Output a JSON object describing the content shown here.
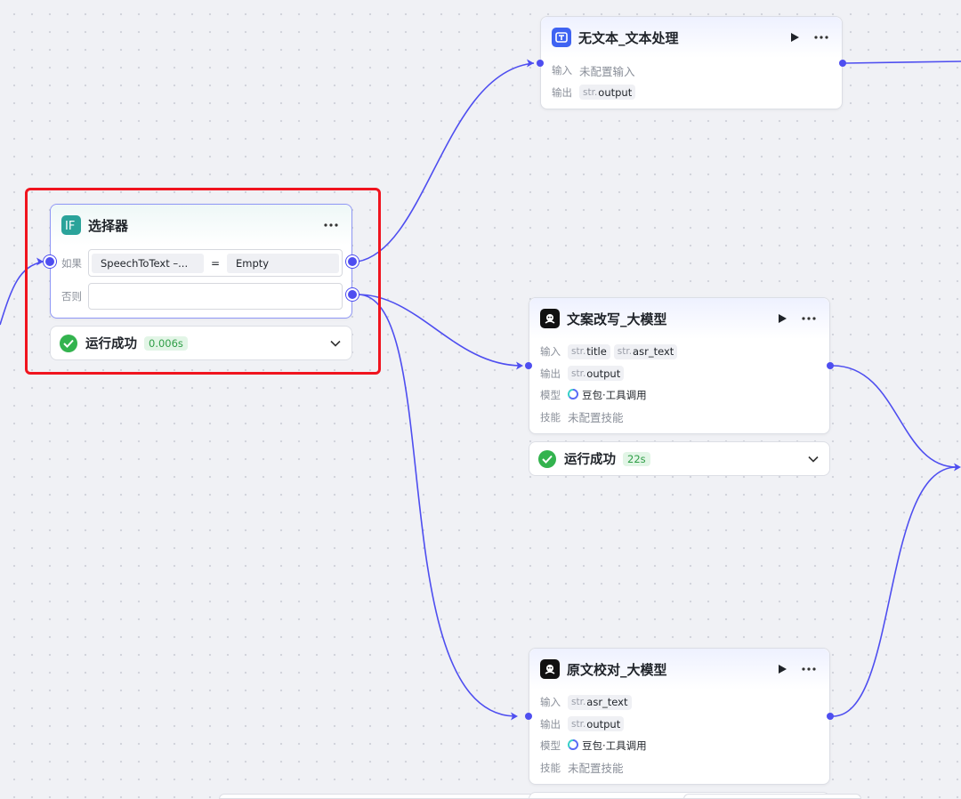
{
  "selector_node": {
    "title": "选择器",
    "icon": "if-icon",
    "if_label": "如果",
    "else_label": "否则",
    "condition": {
      "left": "SpeechToText –...",
      "operator": "=",
      "right": "Empty"
    },
    "status": {
      "text": "运行成功",
      "time": "0.006s"
    }
  },
  "text_node": {
    "title": "无文本_文本处理",
    "input_label": "输入",
    "input_value": "未配置输入",
    "output_label": "输出",
    "outputs": [
      {
        "type": "str.",
        "name": "output"
      }
    ]
  },
  "rewrite_node": {
    "title": "文案改写_大模型",
    "input_label": "输入",
    "inputs": [
      {
        "type": "str.",
        "name": "title"
      },
      {
        "type": "str.",
        "name": "asr_text"
      }
    ],
    "output_label": "输出",
    "outputs": [
      {
        "type": "str.",
        "name": "output"
      }
    ],
    "model_label": "模型",
    "model_value": "豆包·工具调用",
    "skill_label": "技能",
    "skill_value": "未配置技能",
    "status": {
      "text": "运行成功",
      "time": "22s"
    }
  },
  "proofread_node": {
    "title": "原文校对_大模型",
    "input_label": "输入",
    "inputs": [
      {
        "type": "str.",
        "name": "asr_text"
      }
    ],
    "output_label": "输出",
    "outputs": [
      {
        "type": "str.",
        "name": "output"
      }
    ],
    "model_label": "模型",
    "model_value": "豆包·工具调用",
    "skill_label": "技能",
    "skill_value": "未配置技能"
  },
  "colors": {
    "edge": "#4e4ef0",
    "highlight": "#f0141e",
    "success": "#33b34e",
    "selector_icon": "#2aa39a"
  }
}
